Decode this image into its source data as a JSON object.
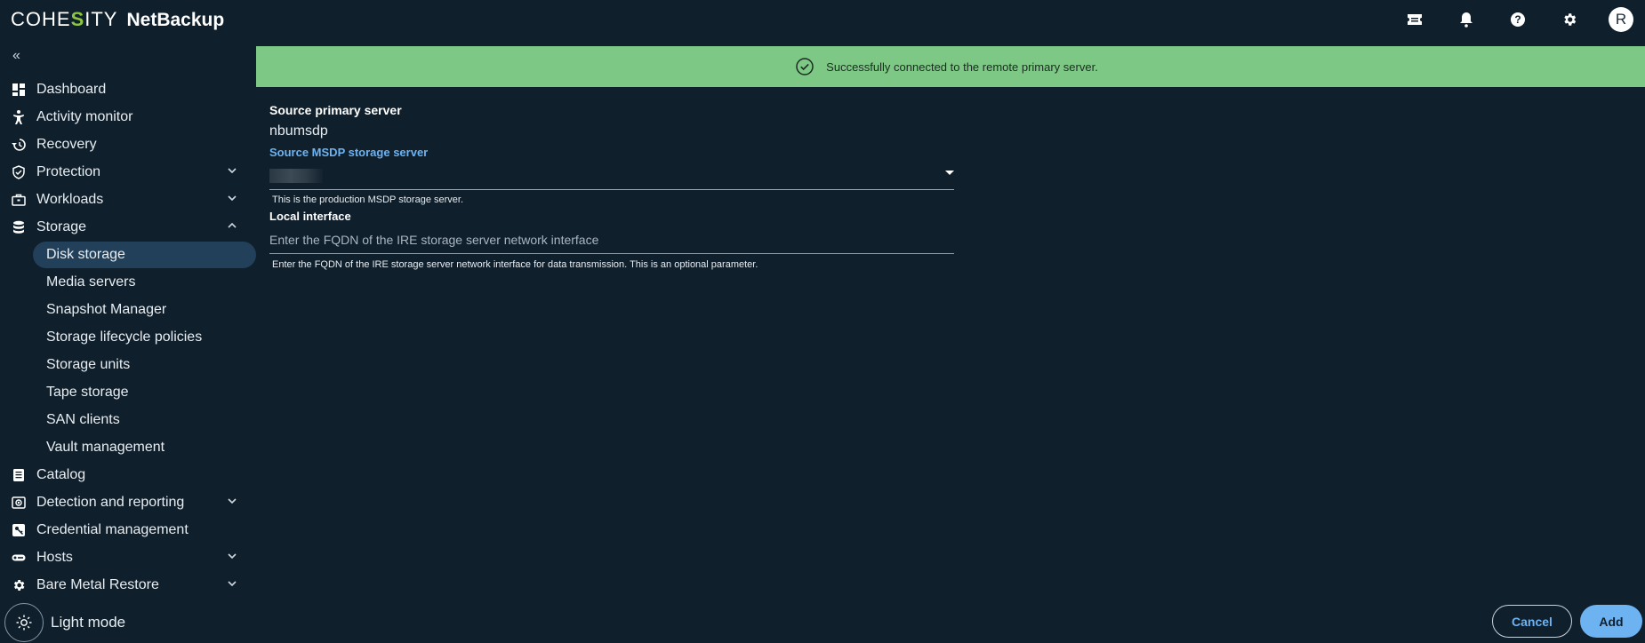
{
  "header": {
    "brand_logo_pre": "COHE",
    "brand_logo_s": "S",
    "brand_logo_post": "ITY",
    "product": "NetBackup",
    "avatar_initial": "R",
    "icons": [
      "ticket-icon",
      "bell-icon",
      "help-icon",
      "gear-icon"
    ]
  },
  "sidebar": {
    "collapse_glyph": "«",
    "items": [
      {
        "label": "Dashboard",
        "icon": "dashboard-icon"
      },
      {
        "label": "Activity monitor",
        "icon": "activity-icon"
      },
      {
        "label": "Recovery",
        "icon": "recovery-icon"
      },
      {
        "label": "Protection",
        "icon": "shield-icon",
        "expandable": true
      },
      {
        "label": "Workloads",
        "icon": "briefcase-icon",
        "expandable": true
      },
      {
        "label": "Storage",
        "icon": "database-icon",
        "expandable": true,
        "expanded": true
      }
    ],
    "storage_sub": [
      {
        "label": "Disk storage",
        "active": true
      },
      {
        "label": "Media servers"
      },
      {
        "label": "Snapshot Manager"
      },
      {
        "label": "Storage lifecycle policies"
      },
      {
        "label": "Storage units"
      },
      {
        "label": "Tape storage"
      },
      {
        "label": "SAN clients"
      },
      {
        "label": "Vault management"
      }
    ],
    "items_after": [
      {
        "label": "Catalog",
        "icon": "catalog-icon"
      },
      {
        "label": "Detection and reporting",
        "icon": "detection-icon",
        "expandable": true
      },
      {
        "label": "Credential management",
        "icon": "key-icon"
      },
      {
        "label": "Hosts",
        "icon": "hosts-icon",
        "expandable": true
      },
      {
        "label": "Bare Metal Restore",
        "icon": "bmr-gear-icon",
        "expandable": true
      }
    ],
    "light_mode_label": "Light mode"
  },
  "banner": {
    "message": "Successfully connected to the remote primary server.",
    "color": "#7ec885"
  },
  "form": {
    "source_primary_label": "Source primary server",
    "source_primary_value": "nbumsdp",
    "msdp_label": "Source MSDP storage server",
    "msdp_value": "",
    "msdp_hint": "This is the production MSDP storage server.",
    "local_interface_label": "Local interface",
    "local_interface_placeholder": "Enter the FQDN of the IRE storage server network interface",
    "local_interface_hint": "Enter the FQDN of the IRE storage server network interface for data transmission. This is an optional parameter."
  },
  "actions": {
    "cancel_label": "Cancel",
    "add_label": "Add"
  },
  "colors": {
    "background": "#0f1f2c",
    "accent": "#6db3f2",
    "active_nav": "#22405a",
    "brand_green": "#8cc63f"
  }
}
